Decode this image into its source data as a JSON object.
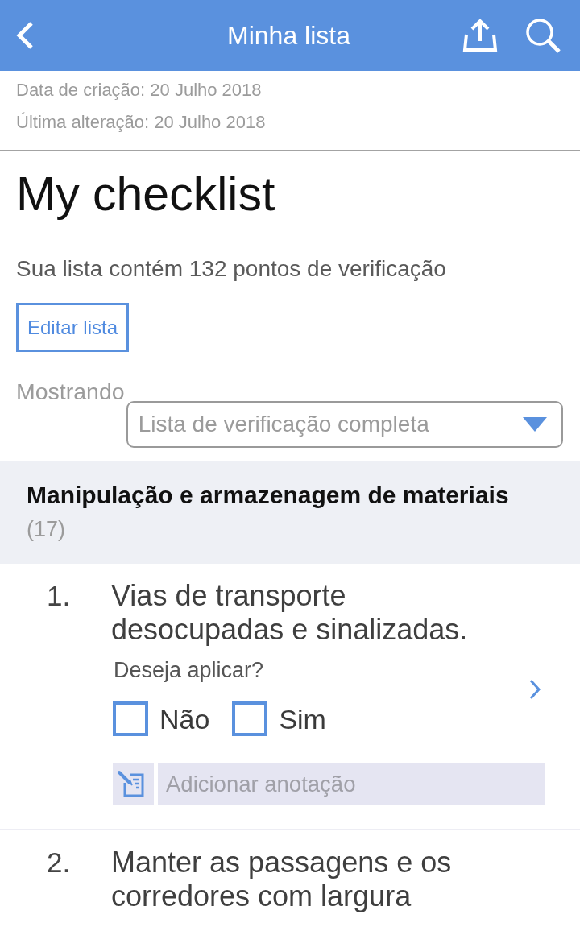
{
  "header": {
    "title": "Minha lista"
  },
  "meta": [
    "Data de criação: 20 Julho 2018",
    "Última alteração: 20 Julho 2018"
  ],
  "checklist": {
    "title": "My checklist",
    "summary": "Sua lista contém 132 pontos de verificação",
    "edit_button": "Editar lista"
  },
  "filter": {
    "label": "Mostrando",
    "value": "Lista de verificação completa"
  },
  "section": {
    "title": "Manipulação e armazenagem de materiais",
    "count": "(17)"
  },
  "items": [
    {
      "number": "1.",
      "question": "Vias de transporte desocupadas e sinalizadas.",
      "prompt": "Deseja aplicar?",
      "options": [
        {
          "label": "Não",
          "checked": false
        },
        {
          "label": "Sim",
          "checked": false
        }
      ],
      "note": {
        "placeholder": "Adicionar anotação"
      }
    },
    {
      "number": "2.",
      "question": "Manter as passagens e os corredores com largura"
    }
  ]
}
